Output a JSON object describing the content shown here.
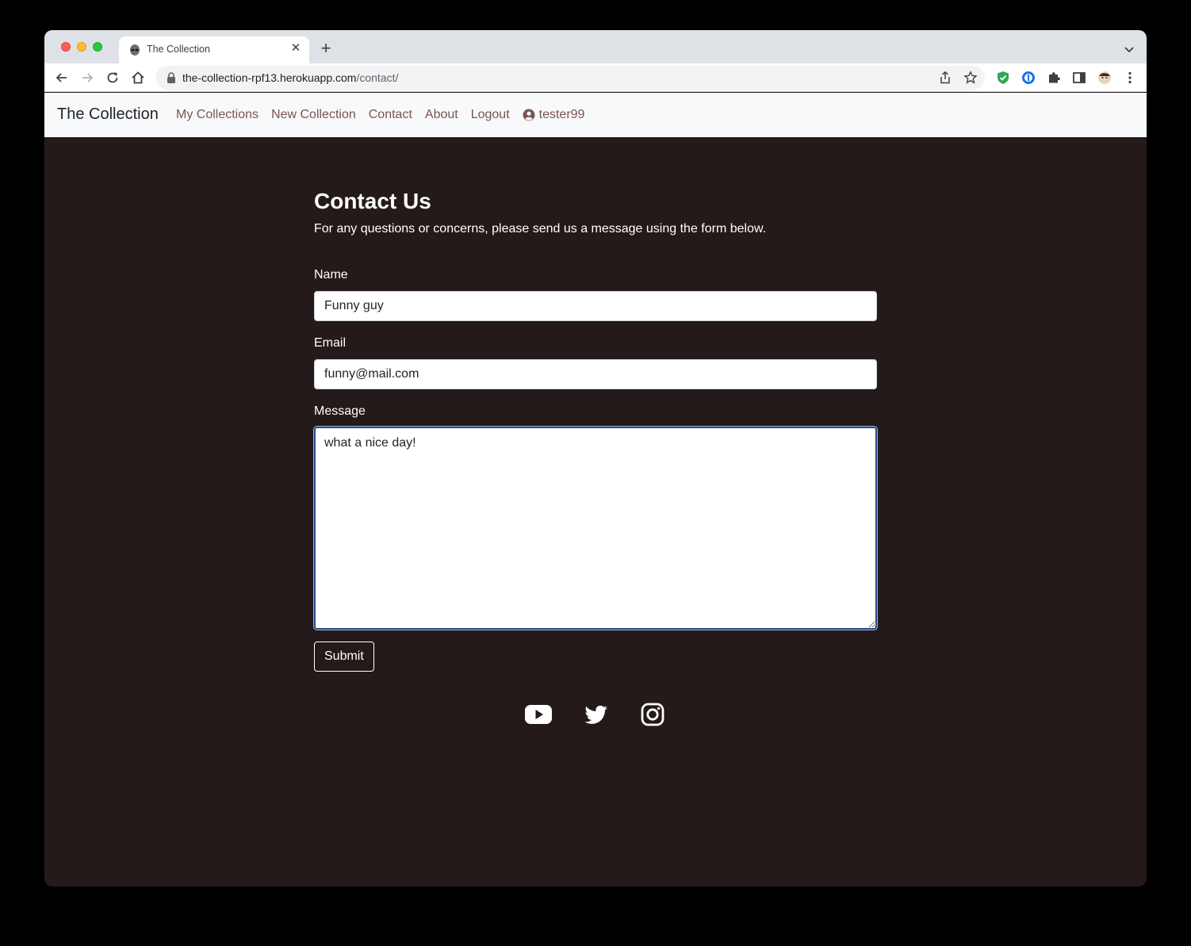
{
  "browser": {
    "tab_title": "The Collection",
    "url_host": "the-collection-rpf13.herokuapp.com",
    "url_path": "/contact/"
  },
  "navbar": {
    "brand": "The Collection",
    "links": [
      "My Collections",
      "New Collection",
      "Contact",
      "About",
      "Logout"
    ],
    "username": "tester99"
  },
  "page": {
    "heading": "Contact Us",
    "intro": "For any questions or concerns, please send us a message using the form below."
  },
  "form": {
    "name_label": "Name",
    "name_value": "Funny guy",
    "email_label": "Email",
    "email_value": "funny@mail.com",
    "message_label": "Message",
    "message_value": "what a nice day!",
    "submit_label": "Submit"
  },
  "social": [
    "youtube-icon",
    "twitter-icon",
    "instagram-icon"
  ]
}
